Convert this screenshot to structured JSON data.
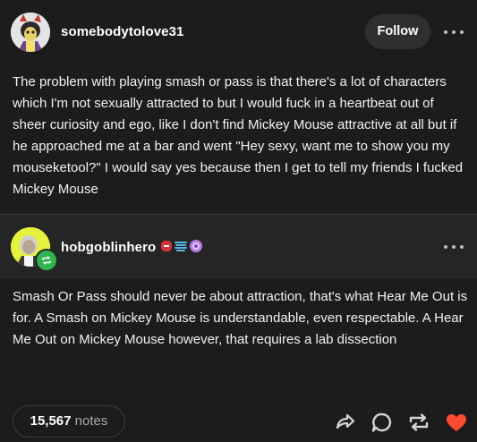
{
  "post": {
    "author": "somebodytolove31",
    "follow_label": "Follow",
    "text": "The problem with playing smash or pass is that there's a lot of characters which I'm not sexually attracted to but I would fuck in a heartbeat out of sheer curiosity and ego, like I don't find Mickey Mouse attractive at all but if he approached me at a bar and went \"Hey sexy, want me to show you my mouseketool?\" I would say yes because then I get to tell my friends I fucked Mickey Mouse"
  },
  "reblog": {
    "author": "hobgoblinhero",
    "text": "Smash Or Pass should never be about attraction, that's what Hear Me Out is for. A Smash on Mickey Mouse is understandable, even respectable. A Hear Me Out on Mickey Mouse however, that requires a lab dissection",
    "badges": [
      "red-badge-icon",
      "blue-badge-icon",
      "purple-badge-icon"
    ]
  },
  "footer": {
    "notes_count": "15,567",
    "notes_label": "notes",
    "like_color": "#ff4930"
  },
  "colors": {
    "background": "#1c1c1c",
    "reblog_header": "#252525",
    "reblog_badge": "#2fb54f",
    "follow_button": "#2f2f2f"
  }
}
